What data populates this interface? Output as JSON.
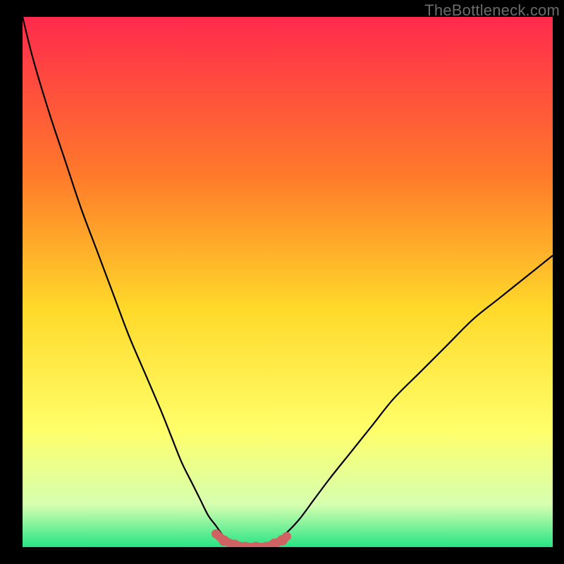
{
  "watermark": {
    "text": "TheBottleneck.com"
  },
  "colors": {
    "background": "#000000",
    "curve": "#000000",
    "marker": "#cf6363",
    "gradient_top": "#ff2a4d",
    "gradient_mid1": "#ff7a2a",
    "gradient_mid2": "#ffd92a",
    "gradient_mid3": "#ffff6a",
    "gradient_mid4": "#d6ffb0",
    "gradient_bottom": "#27e484"
  },
  "chart_data": {
    "type": "line",
    "title": "",
    "xlabel": "",
    "ylabel": "",
    "xlim": [
      0,
      100
    ],
    "ylim": [
      0,
      100
    ],
    "grid": false,
    "legend": false,
    "series": [
      {
        "name": "bottleneck-curve",
        "x": [
          0,
          2,
          5,
          8,
          11,
          14,
          17,
          20,
          23,
          26,
          28,
          30,
          32,
          33.5,
          35,
          36.5,
          38,
          40,
          42,
          44,
          46,
          49,
          52,
          55,
          58,
          62,
          66,
          70,
          75,
          80,
          85,
          90,
          95,
          100
        ],
        "y": [
          100,
          92,
          82,
          73,
          64,
          56,
          48,
          40,
          33,
          26,
          21,
          16,
          12,
          9,
          6,
          4,
          2,
          1,
          0,
          0,
          0,
          2,
          5,
          9,
          13,
          18,
          23,
          28,
          33,
          38,
          43,
          47,
          51,
          55
        ]
      }
    ],
    "flat_segment": {
      "x_start": 38,
      "x_end": 49,
      "y": 0,
      "marker_x": [
        36.5,
        38,
        40,
        42,
        44,
        46,
        47.5,
        49,
        49.8
      ],
      "marker_y": [
        2.5,
        1.2,
        0.4,
        0,
        0,
        0,
        0.6,
        1.3,
        2.0
      ]
    }
  }
}
